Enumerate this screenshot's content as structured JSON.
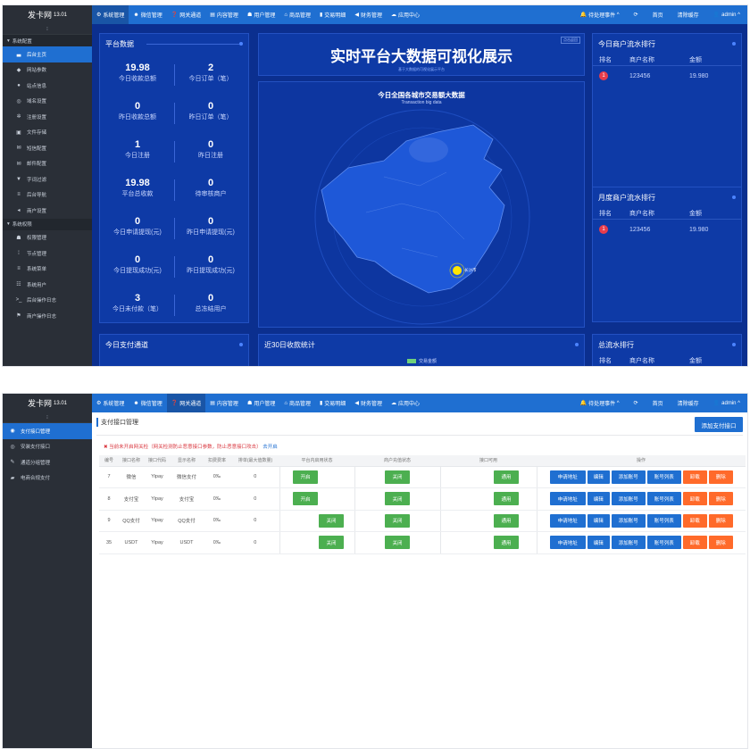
{
  "app": {
    "logo": "发卡网",
    "version": "13.01"
  },
  "nav": {
    "items": [
      {
        "icon": "⚙",
        "label": "系统管理"
      },
      {
        "icon": "☻",
        "label": "微信管理"
      },
      {
        "icon": "❓",
        "label": "网关通道"
      },
      {
        "icon": "▤",
        "label": "内容管理"
      },
      {
        "icon": "☗",
        "label": "用户管理"
      },
      {
        "icon": "⌂",
        "label": "商品管理"
      },
      {
        "icon": "▮",
        "label": "交易明细"
      },
      {
        "icon": "◀",
        "label": "财务管理"
      },
      {
        "icon": "☁",
        "label": "应用中心"
      }
    ],
    "right": {
      "pending": "待处理事件",
      "home": "首页",
      "clear_cache": "清除缓存",
      "user": "admin"
    }
  },
  "sidebar1": {
    "toggle": "⁝",
    "groups": [
      {
        "label": "系统配置",
        "items": [
          {
            "icon": "▃",
            "label": "后台主页"
          },
          {
            "icon": "◆",
            "label": "网站参数"
          },
          {
            "icon": "●",
            "label": "站点信息"
          },
          {
            "icon": "◎",
            "label": "域名设置"
          },
          {
            "icon": "✲",
            "label": "注册设置"
          },
          {
            "icon": "▣",
            "label": "文件存储"
          },
          {
            "icon": "✉",
            "label": "短信配置"
          },
          {
            "icon": "✉",
            "label": "邮件配置"
          },
          {
            "icon": "▼",
            "label": "字词过滤"
          },
          {
            "icon": "≡",
            "label": "后台导航"
          },
          {
            "icon": "◂",
            "label": "商户设置"
          }
        ]
      },
      {
        "label": "系统权限",
        "items": [
          {
            "icon": "☗",
            "label": "权限管理"
          },
          {
            "icon": "⁞",
            "label": "节点管理"
          },
          {
            "icon": "≡",
            "label": "系统菜单"
          },
          {
            "icon": "☷",
            "label": "系统用户"
          },
          {
            "icon": ">_",
            "label": "后台操作日志"
          },
          {
            "icon": "⚑",
            "label": "商户操作日志"
          }
        ]
      }
    ]
  },
  "dashboard": {
    "platform_title": "平台数据",
    "stats": [
      {
        "value": "19.98",
        "label": "今日收款总额"
      },
      {
        "value": "2",
        "label": "今日订单（笔）"
      },
      {
        "value": "0",
        "label": "昨日收款总额"
      },
      {
        "value": "0",
        "label": "昨日订单（笔）"
      },
      {
        "value": "1",
        "label": "今日注册"
      },
      {
        "value": "0",
        "label": "昨日注册"
      },
      {
        "value": "19.98",
        "label": "平台总收款"
      },
      {
        "value": "0",
        "label": "待审核商户"
      },
      {
        "value": "0",
        "label": "今日申请提现(元)"
      },
      {
        "value": "0",
        "label": "昨日申请提现(元)"
      },
      {
        "value": "0",
        "label": "今日提现成功(元)"
      },
      {
        "value": "0",
        "label": "昨日提现成功(元)"
      },
      {
        "value": "3",
        "label": "今日未付款（笔）"
      },
      {
        "value": "0",
        "label": "总冻结用户"
      }
    ],
    "big_title": "实时平台大数据可视化展示",
    "big_subtitle": "基于大数据的可视化展示平台",
    "corner_button": "点击返回",
    "map_title": "今日全国各城市交易额大数据",
    "map_subtitle": "Transaction big data",
    "map_city": "长沙市",
    "rank_today": {
      "title": "今日商户流水排行",
      "cols": [
        "排名",
        "商户名称",
        "金额"
      ],
      "rows": [
        {
          "rank": "1",
          "name": "123456",
          "amount": "19.980"
        }
      ]
    },
    "rank_month": {
      "title": "月度商户流水排行",
      "cols": [
        "排名",
        "商户名称",
        "金额"
      ],
      "rows": [
        {
          "rank": "1",
          "name": "123456",
          "amount": "19.980"
        }
      ]
    },
    "rank_total": {
      "title": "总流水排行",
      "cols": [
        "排名",
        "商户名称",
        "金额"
      ]
    },
    "pay_channel_title": "今日支付通道",
    "stat30_title": "近30日收款统计",
    "stat30_legend": "交易金额"
  },
  "sidebar2": {
    "toggle": "⁝",
    "items": [
      {
        "icon": "◉",
        "label": "支付接口管理"
      },
      {
        "icon": "◎",
        "label": "安装支付接口"
      },
      {
        "icon": "✎",
        "label": "通道分组管理"
      },
      {
        "icon": "▰",
        "label": "电商合规支付"
      }
    ]
  },
  "payment": {
    "page_title": "支付接口管理",
    "add_button": "添加支付接口",
    "notice": "当前未开启网关检（网关检测防止恶意接口参数，防止恶意接口攻击）",
    "notice_link": "去开启",
    "columns": [
      "编号",
      "接口名称",
      "接口代码",
      "显示名称",
      "扣费费率",
      "排单(最大值数量)",
      "平台内启用状态",
      "商户充值状态",
      "接口可用",
      "操作"
    ],
    "rows": [
      {
        "id": "7",
        "name": "微信",
        "code": "Yipay",
        "display": "微信支付",
        "rate": "0‰",
        "limit": "0",
        "platform": "开启",
        "merchant": "关闭",
        "usable": "通用"
      },
      {
        "id": "8",
        "name": "支付宝",
        "code": "Yipay",
        "display": "支付宝",
        "rate": "0‰",
        "limit": "0",
        "platform": "开启",
        "merchant": "关闭",
        "usable": "通用"
      },
      {
        "id": "9",
        "name": "QQ支付",
        "code": "Yipay",
        "display": "QQ支付",
        "rate": "0‰",
        "limit": "0",
        "platform": "关闭",
        "merchant": "关闭",
        "usable": "通用"
      },
      {
        "id": "35",
        "name": "USDT",
        "code": "Yipay",
        "display": "USDT",
        "rate": "0‰",
        "limit": "0",
        "platform": "关闭",
        "merchant": "关闭",
        "usable": "通用"
      }
    ],
    "ops": [
      "申请地址",
      "编辑",
      "添加账号",
      "账号列表",
      "卸载",
      "删除"
    ]
  }
}
